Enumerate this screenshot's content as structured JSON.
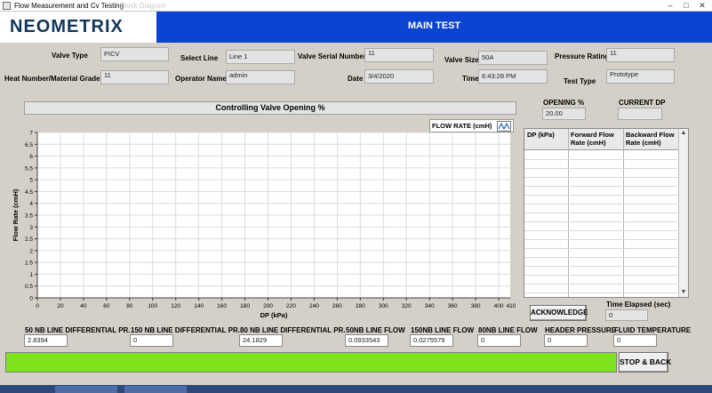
{
  "window": {
    "title": "Flow Measurement and Cv Testing",
    "ghost_text": "Block Diagram"
  },
  "header": {
    "logo": "NEOMETRIX",
    "main_title": "MAIN TEST"
  },
  "form": {
    "valve_type": {
      "label": "Valve Type",
      "value": "PICV"
    },
    "select_line": {
      "label": "Select Line",
      "value": "Line 1"
    },
    "valve_serial": {
      "label": "Valve Serial Number",
      "value": "11"
    },
    "valve_size": {
      "label": "Valve Size",
      "value": "50A"
    },
    "pressure_rating": {
      "label": "Pressure Rating",
      "value": "11"
    },
    "heat_number": {
      "label": "Heat Number/Material Grade",
      "value": "11"
    },
    "operator": {
      "label": "Operator Name",
      "value": "admin"
    },
    "date": {
      "label": "Date",
      "value": "3/4/2020"
    },
    "time": {
      "label": "Time",
      "value": "6:43:28 PM"
    },
    "test_type": {
      "label": "Test Type",
      "value": "Prototype"
    }
  },
  "opening": {
    "label": "OPENING %",
    "value": "20.00"
  },
  "current_dp": {
    "label": "CURRENT DP",
    "value": ""
  },
  "chart_banner": "Controlling Valve Opening %",
  "legend": {
    "label": "FLOW RATE (cmH)"
  },
  "chart_data": {
    "type": "line",
    "xlabel": "DP (kPa)",
    "ylabel": "Flow Rate (cmH)",
    "xlim": [
      0,
      410
    ],
    "ylim": [
      0,
      7
    ],
    "xticks": [
      0,
      20,
      40,
      60,
      80,
      100,
      120,
      140,
      160,
      180,
      200,
      220,
      240,
      260,
      280,
      300,
      320,
      340,
      360,
      380,
      400
    ],
    "xtick_labels": [
      "0",
      "20",
      "40",
      "60",
      "80",
      "100",
      "120",
      "140",
      "160",
      "180",
      "200",
      "220",
      "240",
      "260",
      "280",
      "300",
      "320",
      "340",
      "360",
      "380",
      "400"
    ],
    "last_xtick": {
      "value": 410,
      "label": "410"
    },
    "yticks": [
      0,
      0.5,
      1,
      1.5,
      2,
      2.5,
      3,
      3.5,
      4,
      4.5,
      5,
      5.5,
      6,
      6.5,
      7
    ],
    "ytick_labels": [
      "0",
      "0.5",
      "1",
      "1.5",
      "2",
      "2.5",
      "3",
      "3.5",
      "4",
      "4.5",
      "5",
      "5.5",
      "6",
      "6.5",
      "7"
    ],
    "grid": true,
    "series": [
      {
        "name": "FLOW RATE (cmH)",
        "x": [],
        "y": []
      }
    ],
    "colors": {
      "grid": "#dcdcdc",
      "plot_bg": "#ffffff"
    }
  },
  "table": {
    "headers": [
      "DP (kPa)",
      "Forward Flow Rate (cmH)",
      "Backward Flow Rate (cmH)"
    ],
    "rows": []
  },
  "time_elapsed": {
    "label": "Time Elapsed (sec)",
    "value": "0"
  },
  "acknowledge": {
    "label": "ACKNOWLEDGE"
  },
  "readings": {
    "nb50_dp": {
      "label": "50 NB LINE DIFFERENTIAL PR.",
      "value": "2.8394"
    },
    "nb150_dp": {
      "label": "150 NB LINE DIFFERENTIAL PR.",
      "value": "0"
    },
    "nb80_dp": {
      "label": "80 NB LINE DIFFERENTIAL PR.",
      "value": "24.1829"
    },
    "nb50_flow": {
      "label": "50NB LINE FLOW",
      "value": "0.0933543"
    },
    "nb150_flow": {
      "label": "150NB LINE FLOW",
      "value": "0.0275579"
    },
    "nb80_flow": {
      "label": "80NB LINE FLOW",
      "value": "0"
    },
    "header_pressure": {
      "label": "HEADER PRESSURE",
      "value": "0"
    },
    "fluid_temp": {
      "label": "FLUID TEMPERATURE",
      "value": "0"
    }
  },
  "progress": {
    "fraction": 1.0,
    "color": "#7ee21c"
  },
  "stop_back": {
    "label": "STOP & BACK"
  }
}
